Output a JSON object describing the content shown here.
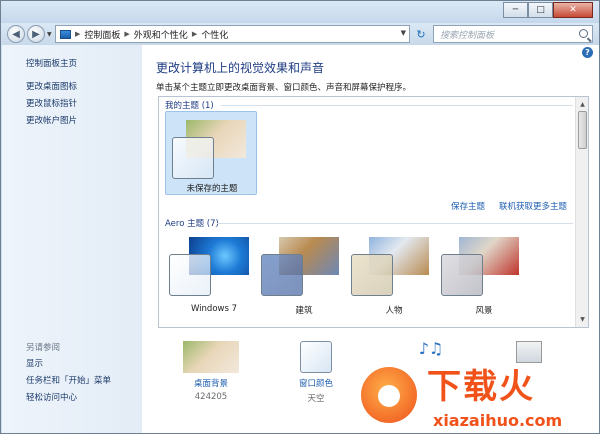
{
  "titlebar": {
    "min": "─",
    "max": "□",
    "close": "✕"
  },
  "nav": {
    "back": "◀",
    "forward": "▶",
    "breadcrumbs": [
      "控制面板",
      "外观和个性化",
      "个性化"
    ],
    "search_placeholder": "搜索控制面板",
    "refresh": "↻"
  },
  "leftpane": {
    "links": [
      "控制面板主页",
      "更改桌面图标",
      "更改鼠标指针",
      "更改帐户图片"
    ],
    "see_also_header": "另请参阅",
    "see_also": [
      "显示",
      "任务栏和「开始」菜单",
      "轻松访问中心"
    ]
  },
  "content": {
    "title": "更改计算机上的视觉效果和声音",
    "subtitle": "单击某个主题立即更改桌面背景、窗口颜色、声音和屏幕保护程序。",
    "my_themes": {
      "header": "我的主题 (1)",
      "items": [
        {
          "label": "未保存的主题"
        }
      ]
    },
    "actions": {
      "save": "保存主题",
      "online": "联机获取更多主题"
    },
    "aero": {
      "header": "Aero 主题 (7)",
      "items": [
        {
          "label": "Windows 7"
        },
        {
          "label": "建筑"
        },
        {
          "label": "人物"
        },
        {
          "label": "风景"
        }
      ]
    }
  },
  "bottom": {
    "items": [
      {
        "label": "桌面背景",
        "sub": "424205"
      },
      {
        "label": "窗口颜色",
        "sub": "天空"
      }
    ]
  },
  "watermark": {
    "brand": "下载火",
    "url": "xiazaihuo.com"
  },
  "colors": {
    "link": "#1f5eb0",
    "title": "#1e3c82",
    "selection": "#cde3f8"
  }
}
